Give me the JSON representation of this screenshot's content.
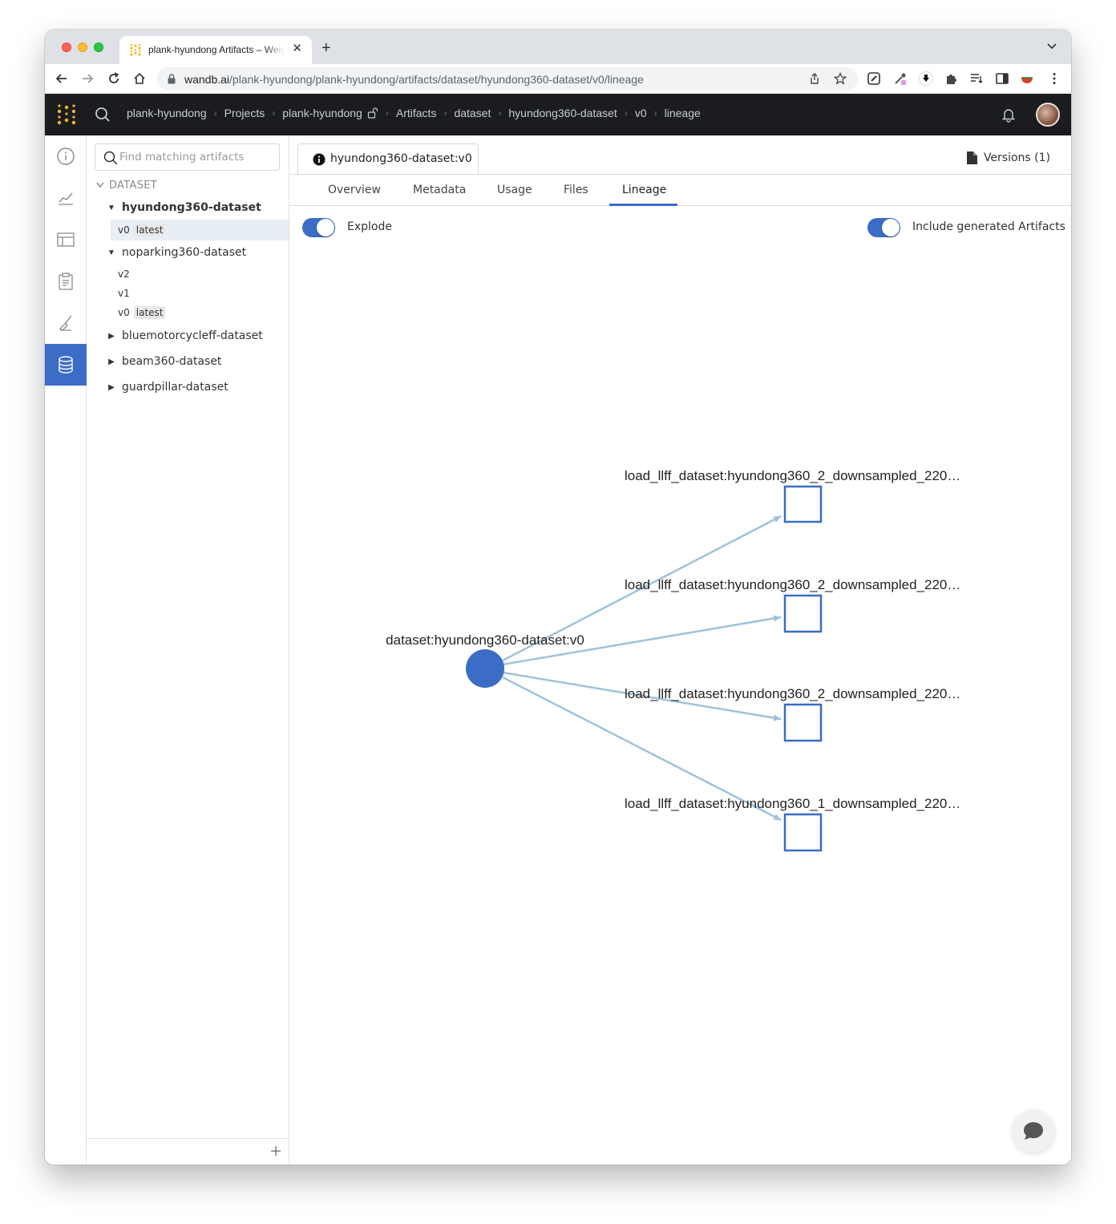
{
  "browser": {
    "tab_title": "plank-hyundong Artifacts – Weights & Biases",
    "url_host": "wandb.ai",
    "url_path": "/plank-hyundong/plank-hyundong/artifacts/dataset/hyundong360-dataset/v0/lineage",
    "icons": [
      "back-icon",
      "forward-icon",
      "reload-icon",
      "home-icon",
      "lock-icon",
      "share-icon",
      "star-icon",
      "extension-icon"
    ]
  },
  "nav": {
    "breadcrumbs": [
      "plank-hyundong",
      "Projects",
      "plank-hyundong",
      "Artifacts",
      "dataset",
      "hyundong360-dataset",
      "v0",
      "lineage"
    ]
  },
  "rail": {
    "items": [
      "overview-icon",
      "charts-icon",
      "table-icon",
      "reports-icon",
      "sweeps-icon",
      "artifacts-icon"
    ],
    "active": "artifacts-icon"
  },
  "tree": {
    "search_placeholder": "Find matching artifacts",
    "category": "DATASET",
    "artifacts": [
      {
        "name": "hyundong360-dataset",
        "expanded": true,
        "bold": true,
        "versions": [
          {
            "version": "v0",
            "alias": "latest",
            "selected": true
          }
        ]
      },
      {
        "name": "noparking360-dataset",
        "expanded": true,
        "bold": false,
        "versions": [
          {
            "version": "v2",
            "alias": ""
          },
          {
            "version": "v1",
            "alias": ""
          },
          {
            "version": "v0",
            "alias": "latest"
          }
        ]
      },
      {
        "name": "bluemotorcycleff-dataset",
        "expanded": false
      },
      {
        "name": "beam360-dataset",
        "expanded": false
      },
      {
        "name": "guardpillar-dataset",
        "expanded": false
      }
    ]
  },
  "main": {
    "artifact_tab": "hyundong360-dataset:v0",
    "versions_label": "Versions (1)",
    "tabs": [
      "Overview",
      "Metadata",
      "Usage",
      "Files",
      "Lineage"
    ],
    "active_tab": "Lineage",
    "explode_label": "Explode",
    "explode_on": true,
    "include_label": "Include generated Artifacts",
    "include_on": true
  },
  "lineage": {
    "source": {
      "label": "dataset:hyundong360-dataset:v0",
      "color": "#3b6cc6"
    },
    "targets": [
      {
        "label": "load_llff_dataset:hyundong360_2_downsampled_220…"
      },
      {
        "label": "load_llff_dataset:hyundong360_2_downsampled_220…"
      },
      {
        "label": "load_llff_dataset:hyundong360_2_downsampled_220…"
      },
      {
        "label": "load_llff_dataset:hyundong360_1_downsampled_220…"
      }
    ],
    "edge_color": "#9ec3d8",
    "node_stroke": "#3b6cc6"
  }
}
